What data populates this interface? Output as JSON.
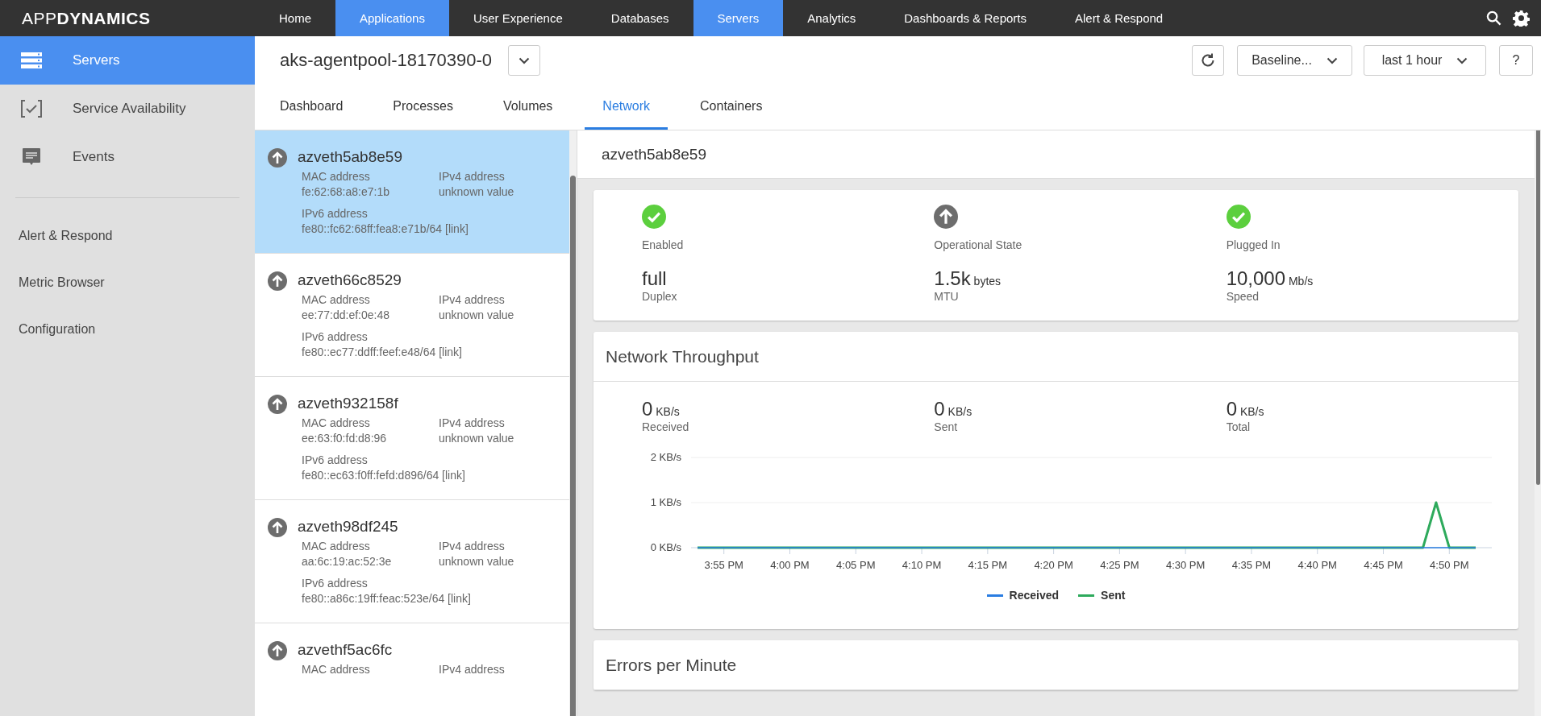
{
  "top_nav": {
    "logo": "APP**DYNAMICS**",
    "items": [
      {
        "label": "Home",
        "selected": false
      },
      {
        "label": "Applications",
        "selected": true
      },
      {
        "label": "User Experience",
        "selected": false
      },
      {
        "label": "Databases",
        "selected": false
      },
      {
        "label": "Servers",
        "selected": true
      },
      {
        "label": "Analytics",
        "selected": false
      },
      {
        "label": "Dashboards & Reports",
        "selected": false
      },
      {
        "label": "Alert & Respond",
        "selected": false
      }
    ]
  },
  "sidebar": {
    "items": [
      {
        "label": "Servers",
        "selected": true
      },
      {
        "label": "Service Availability",
        "selected": false
      },
      {
        "label": "Events",
        "selected": false
      }
    ],
    "links": [
      "Alert & Respond",
      "Metric Browser",
      "Configuration"
    ]
  },
  "header": {
    "title": "aks-agentpool-18170390-0",
    "baseline": "Baseline...",
    "time_range": "last 1 hour",
    "help": "?"
  },
  "tabs": [
    {
      "label": "Dashboard",
      "selected": false
    },
    {
      "label": "Processes",
      "selected": false
    },
    {
      "label": "Volumes",
      "selected": false
    },
    {
      "label": "Network",
      "selected": true
    },
    {
      "label": "Containers",
      "selected": false
    }
  ],
  "interfaces": [
    {
      "name": "azveth5ab8e59",
      "selected": true,
      "mac_label": "MAC address",
      "mac": "fe:62:68:a8:e7:1b",
      "ipv4_label": "IPv4 address",
      "ipv4": "unknown value",
      "ipv6_label": "IPv6 address",
      "ipv6": "fe80::fc62:68ff:fea8:e71b/64 [link]"
    },
    {
      "name": "azveth66c8529",
      "selected": false,
      "mac_label": "MAC address",
      "mac": "ee:77:dd:ef:0e:48",
      "ipv4_label": "IPv4 address",
      "ipv4": "unknown value",
      "ipv6_label": "IPv6 address",
      "ipv6": "fe80::ec77:ddff:feef:e48/64 [link]"
    },
    {
      "name": "azveth932158f",
      "selected": false,
      "mac_label": "MAC address",
      "mac": "ee:63:f0:fd:d8:96",
      "ipv4_label": "IPv4 address",
      "ipv4": "unknown value",
      "ipv6_label": "IPv6 address",
      "ipv6": "fe80::ec63:f0ff:fefd:d896/64 [link]"
    },
    {
      "name": "azveth98df245",
      "selected": false,
      "mac_label": "MAC address",
      "mac": "aa:6c:19:ac:52:3e",
      "ipv4_label": "IPv4 address",
      "ipv4": "unknown value",
      "ipv6_label": "IPv6 address",
      "ipv6": "fe80::a86c:19ff:feac:523e/64 [link]"
    },
    {
      "name": "azvethf5ac6fc",
      "selected": false,
      "mac_label": "MAC address",
      "ipv4_label": "IPv4 address"
    }
  ],
  "detail": {
    "title": "azveth5ab8e59",
    "status": [
      {
        "label": "Enabled",
        "kind": "check"
      },
      {
        "label": "Operational State",
        "kind": "up"
      },
      {
        "label": "Plugged In",
        "kind": "check"
      }
    ],
    "stats": [
      {
        "value": "full",
        "label": "Duplex"
      },
      {
        "value": "1.5k",
        "unit": "bytes",
        "label": "MTU"
      },
      {
        "value": "10,000",
        "unit": "Mb/s",
        "label": "Speed"
      }
    ]
  },
  "throughput": {
    "title": "Network Throughput",
    "stats": [
      {
        "value": "0",
        "unit": "KB/s",
        "label": "Received"
      },
      {
        "value": "0",
        "unit": "KB/s",
        "label": "Sent"
      },
      {
        "value": "0",
        "unit": "KB/s",
        "label": "Total"
      }
    ],
    "chart_data": {
      "type": "line",
      "categories": [
        null,
        null,
        "3:55 PM",
        null,
        null,
        null,
        null,
        "4:00 PM",
        null,
        null,
        null,
        null,
        "4:05 PM",
        null,
        null,
        null,
        null,
        "4:10 PM",
        null,
        null,
        null,
        null,
        "4:15 PM",
        null,
        null,
        null,
        null,
        "4:20 PM",
        null,
        null,
        null,
        null,
        "4:25 PM",
        null,
        null,
        null,
        null,
        "4:30 PM",
        null,
        null,
        null,
        null,
        "4:35 PM",
        null,
        null,
        null,
        null,
        "4:40 PM",
        null,
        null,
        null,
        null,
        "4:45 PM",
        null,
        null,
        null,
        null,
        "4:50 PM",
        null,
        null
      ],
      "ylim": [
        0,
        2
      ],
      "yticks": [
        {
          "value": 0,
          "label": "0 KB/s"
        },
        {
          "value": 1,
          "label": "1 KB/s"
        },
        {
          "value": 2,
          "label": "2 KB/s"
        }
      ],
      "series": [
        {
          "name": "Received",
          "color": "#2a7de1",
          "values": [
            0,
            0,
            0,
            0,
            0,
            0,
            0,
            0,
            0,
            0,
            0,
            0,
            0,
            0,
            0,
            0,
            0,
            0,
            0,
            0,
            0,
            0,
            0,
            0,
            0,
            0,
            0,
            0,
            0,
            0,
            0,
            0,
            0,
            0,
            0,
            0,
            0,
            0,
            0,
            0,
            0,
            0,
            0,
            0,
            0,
            0,
            0,
            0,
            0,
            0,
            0,
            0,
            0,
            0,
            0,
            0,
            0,
            0,
            0,
            0
          ]
        },
        {
          "name": "Sent",
          "color": "#2eaa5c",
          "values": [
            0,
            0,
            0,
            0,
            0,
            0,
            0,
            0,
            0,
            0,
            0,
            0,
            0,
            0,
            0,
            0,
            0,
            0,
            0,
            0,
            0,
            0,
            0,
            0,
            0,
            0,
            0,
            0,
            0,
            0,
            0,
            0,
            0,
            0,
            0,
            0,
            0,
            0,
            0,
            0,
            0,
            0,
            0,
            0,
            0,
            0,
            0,
            0,
            0,
            0,
            0,
            0,
            0,
            0,
            0,
            0,
            1,
            0,
            0,
            0
          ]
        }
      ]
    }
  },
  "errors": {
    "title": "Errors per Minute"
  }
}
